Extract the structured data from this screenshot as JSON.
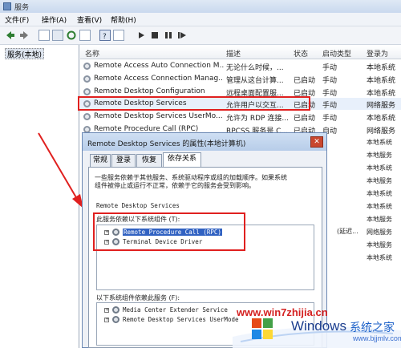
{
  "window": {
    "title": "服务"
  },
  "menu": [
    {
      "label": "文件(F)"
    },
    {
      "label": "操作(A)"
    },
    {
      "label": "查看(V)"
    },
    {
      "label": "帮助(H)"
    }
  ],
  "leftpane": {
    "item": "服务(本地)"
  },
  "columns": {
    "name": "名称",
    "desc": "描述",
    "status": "状态",
    "startup": "启动类型",
    "logon": "登录为"
  },
  "services": [
    {
      "name": "Remote Access Auto Connection M...",
      "desc": "无论什么时候，...",
      "status": "",
      "startup": "手动",
      "logon": "本地系统"
    },
    {
      "name": "Remote Access Connection Manag...",
      "desc": "管理从这台计算...",
      "status": "已启动",
      "startup": "手动",
      "logon": "本地系统"
    },
    {
      "name": "Remote Desktop Configuration",
      "desc": "远程桌面配置服...",
      "status": "已启动",
      "startup": "手动",
      "logon": "本地系统"
    },
    {
      "name": "Remote Desktop Services",
      "desc": "允许用户以交互...",
      "status": "已启动",
      "startup": "手动",
      "logon": "网络服务"
    },
    {
      "name": "Remote Desktop Services UserMo...",
      "desc": "允许为 RDP 连接...",
      "status": "已启动",
      "startup": "手动",
      "logon": "本地系统"
    },
    {
      "name": "Remote Procedure Call (RPC)",
      "desc": "RPCSS 服务是 C...",
      "status": "已启动",
      "startup": "自动",
      "logon": "网络服务"
    }
  ],
  "right_column_overflow": [
    "本地系统",
    "本地服务",
    "本地系统",
    "本地服务",
    "本地系统",
    "(延迟...",
    "本地系统",
    "本地服务",
    "网络服务",
    "本地服务",
    "本地系统"
  ],
  "dialog": {
    "title": "Remote Desktop Services 的属性(本地计算机)",
    "close_glyph": "✕",
    "tabs": [
      "常规",
      "登录",
      "恢复",
      "依存关系"
    ],
    "desc_line1": "一些服务依赖于其他服务、系统驱动程序或组的加载顺序。如果系统",
    "desc_line2": "组件被停止或运行不正常，依赖于它的服务会受到影响。",
    "service_name": "Remote Desktop Services",
    "depends_on_label": "此服务依赖以下系统组件 (T):",
    "depends_on": [
      "Remote Procedure Call (RPC)",
      "Terminal Device Driver"
    ],
    "dependents_label": "以下系统组件依赖此服务 (F):",
    "dependents": [
      "Media Center Extender Service",
      "Remote Desktop Services UserMode"
    ]
  },
  "watermark": {
    "url": "www.win7zhijia.cn",
    "windows": "Windows",
    "suffix": "系统之家",
    "site": "www.bjjmlv.com"
  },
  "colors": {
    "highlight_red": "#e0201f",
    "arrow_red": "#e0201f"
  }
}
